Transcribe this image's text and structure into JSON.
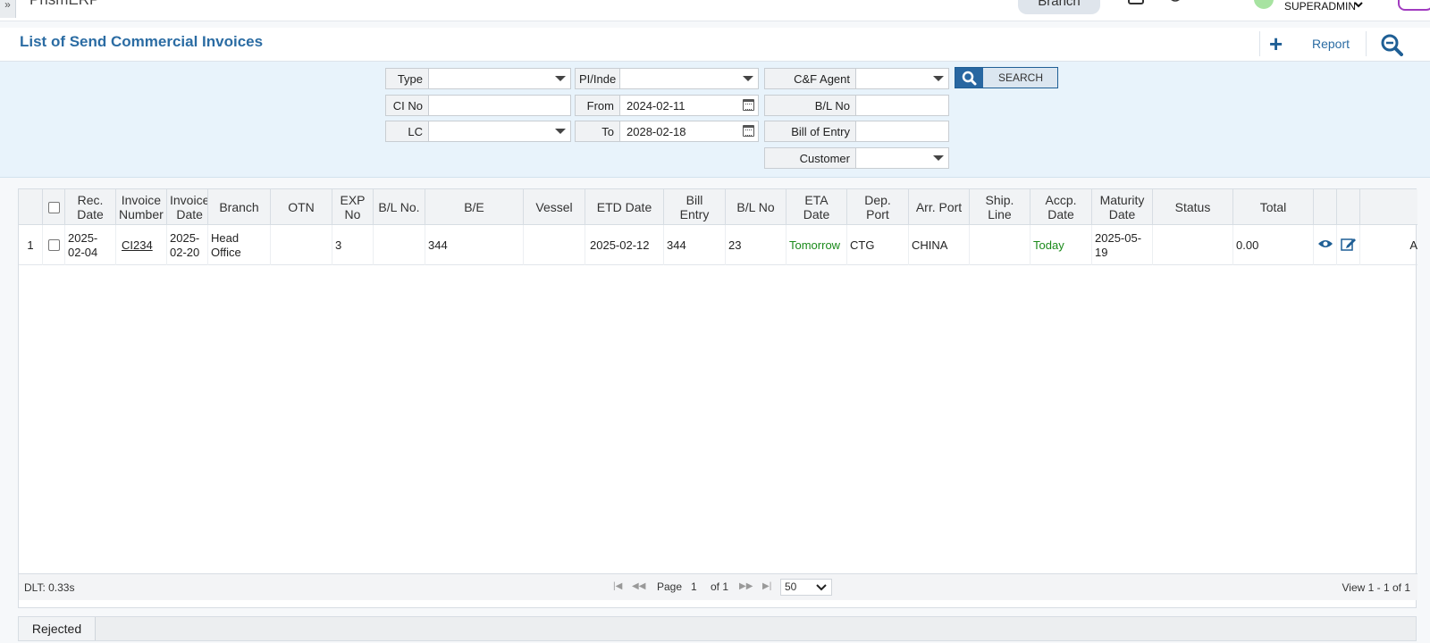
{
  "app": {
    "name": "PrismERP",
    "branch_button": "Branch",
    "user": "SUPERADMIN"
  },
  "page": {
    "title": "List of Send Commercial Invoices",
    "report_label": "Report"
  },
  "filters": {
    "type": {
      "label": "Type",
      "value": ""
    },
    "ci_no": {
      "label": "CI No",
      "value": ""
    },
    "lc": {
      "label": "LC",
      "value": ""
    },
    "pi_indent": {
      "label": "PI/Inde",
      "value": ""
    },
    "from": {
      "label": "From",
      "value": "2024-02-11"
    },
    "to": {
      "label": "To",
      "value": "2028-02-18"
    },
    "cf_agent": {
      "label": "C&F Agent",
      "value": ""
    },
    "bl_no": {
      "label": "B/L No",
      "value": ""
    },
    "bill_of_entry": {
      "label": "Bill of Entry",
      "value": ""
    },
    "customer": {
      "label": "Customer",
      "value": ""
    },
    "search_label": "SEARCH"
  },
  "table": {
    "columns": [
      {
        "key": "rownum",
        "label": ""
      },
      {
        "key": "select",
        "label": ""
      },
      {
        "key": "rec_date",
        "label": "Rec.\nDate"
      },
      {
        "key": "invoice_number",
        "label": "Invoice\nNumber"
      },
      {
        "key": "invoice_date",
        "label": "Invoice\nDate"
      },
      {
        "key": "branch",
        "label": "Branch"
      },
      {
        "key": "otn",
        "label": "OTN"
      },
      {
        "key": "exp_no",
        "label": "EXP\nNo"
      },
      {
        "key": "bl_no_1",
        "label": "B/L No."
      },
      {
        "key": "be",
        "label": "B/E"
      },
      {
        "key": "vessel",
        "label": "Vessel"
      },
      {
        "key": "etd_date",
        "label": "ETD Date"
      },
      {
        "key": "bill_entry",
        "label": "Bill\nEntry"
      },
      {
        "key": "bl_no_2",
        "label": "B/L No"
      },
      {
        "key": "eta_date",
        "label": "ETA\nDate"
      },
      {
        "key": "dep_port",
        "label": "Dep.\nPort"
      },
      {
        "key": "arr_port",
        "label": "Arr. Port"
      },
      {
        "key": "ship_line",
        "label": "Ship.\nLine"
      },
      {
        "key": "accp_date",
        "label": "Accp.\nDate"
      },
      {
        "key": "maturity_date",
        "label": "Maturity\nDate"
      },
      {
        "key": "status",
        "label": "Status"
      },
      {
        "key": "total",
        "label": "Total"
      },
      {
        "key": "view",
        "label": ""
      },
      {
        "key": "edit",
        "label": ""
      },
      {
        "key": "extra",
        "label": ""
      }
    ],
    "rows": [
      {
        "rownum": "1",
        "rec_date": "2025-\n02-04",
        "invoice_number": "CI234",
        "invoice_date": "2025-\n02-20",
        "branch": "Head\nOffice",
        "otn": "",
        "exp_no": "3",
        "bl_no_1": "",
        "be": "344",
        "vessel": "",
        "etd_date": "2025-02-12",
        "bill_entry": "344",
        "bl_no_2": "23",
        "eta_date": "Tomorrow",
        "dep_port": "CTG",
        "arr_port": "CHINA",
        "ship_line": "",
        "accp_date": "Today",
        "maturity_date": "2025-05-\n19",
        "status": "",
        "total": "0.00",
        "extra": "A"
      }
    ]
  },
  "pager": {
    "dlt": "DLT: 0.33s",
    "page_label": "Page",
    "page_value": "1",
    "of_label": "of 1",
    "page_size": "50",
    "view_text": "View 1 - 1 of 1"
  },
  "footer": {
    "tab_label": "Rejected"
  },
  "colors": {
    "accent": "#2b6ca3",
    "green": "#1a8a1a",
    "filter_bg": "#e8f3fb"
  }
}
